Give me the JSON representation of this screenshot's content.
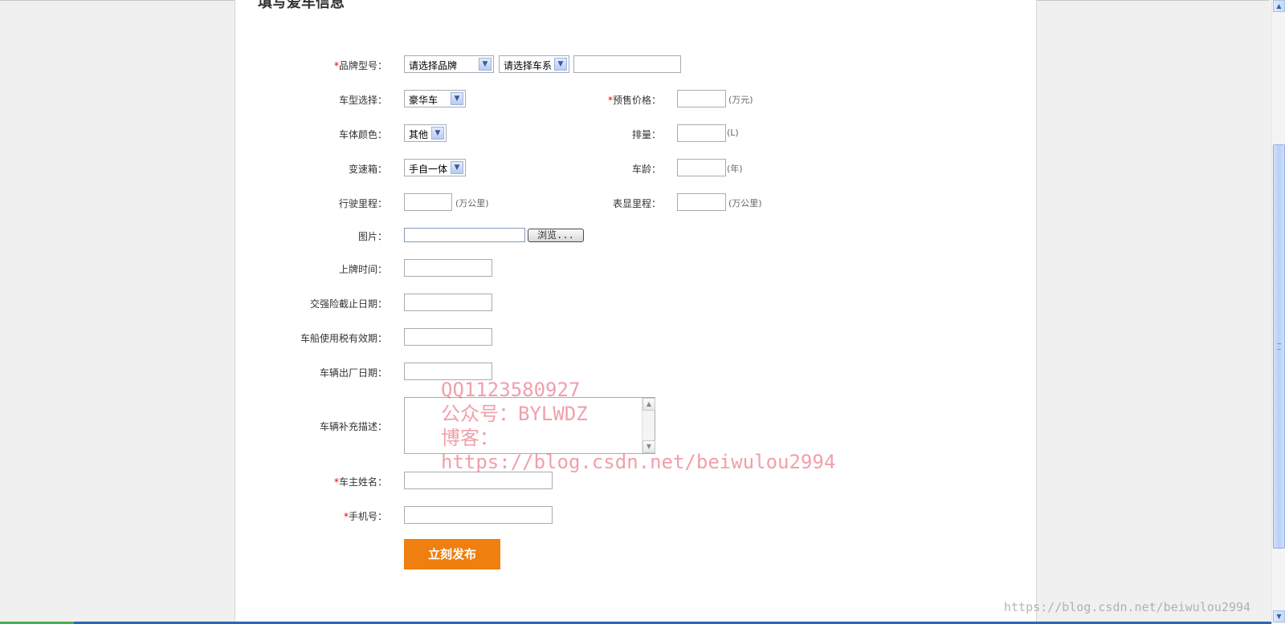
{
  "section": {
    "title": "填写爱车信息"
  },
  "brand": {
    "label": "品牌型号：",
    "required_mark": "*",
    "brand_select": "请选择品牌",
    "series_select": "请选择车系",
    "model_value": ""
  },
  "car_type": {
    "label": "车型选择：",
    "value": "豪华车"
  },
  "price": {
    "label": "预售价格：",
    "required_mark": "*",
    "value": "",
    "unit": "(万元)"
  },
  "color": {
    "label": "车体颜色：",
    "value": "其他"
  },
  "displacement": {
    "label": "排量：",
    "value": "",
    "unit": "(L)"
  },
  "gearbox": {
    "label": "变速箱：",
    "value": "手自一体"
  },
  "age": {
    "label": "车龄：",
    "value": "",
    "unit": "(年)"
  },
  "mileage": {
    "label": "行驶里程：",
    "value": "",
    "unit": "(万公里)"
  },
  "odometer": {
    "label": "表显里程：",
    "value": "",
    "unit": "(万公里)"
  },
  "picture": {
    "label": "图片：",
    "value": "",
    "browse_label": "浏览..."
  },
  "registration_date": {
    "label": "上牌时间：",
    "value": ""
  },
  "insurance_date": {
    "label": "交强险截止日期：",
    "value": ""
  },
  "tax_date": {
    "label": "车船使用税有效期：",
    "value": ""
  },
  "factory_date": {
    "label": "车辆出厂日期：",
    "value": ""
  },
  "description": {
    "label": "车辆补充描述：",
    "value": ""
  },
  "owner_name": {
    "label": "车主姓名：",
    "required_mark": "*",
    "value": ""
  },
  "phone": {
    "label": "手机号：",
    "required_mark": "*",
    "value": ""
  },
  "submit": {
    "label": "立刻发布"
  },
  "watermark": {
    "line1": "QQ1123580927",
    "line2": "公众号：BYLWDZ",
    "line3": "博客：",
    "line4": "https://blog.csdn.net/beiwulou2994"
  },
  "corner_watermark": "https://blog.csdn.net/beiwulou2994",
  "colors": {
    "accent": "#ef7f0f",
    "required": "#e30000"
  }
}
